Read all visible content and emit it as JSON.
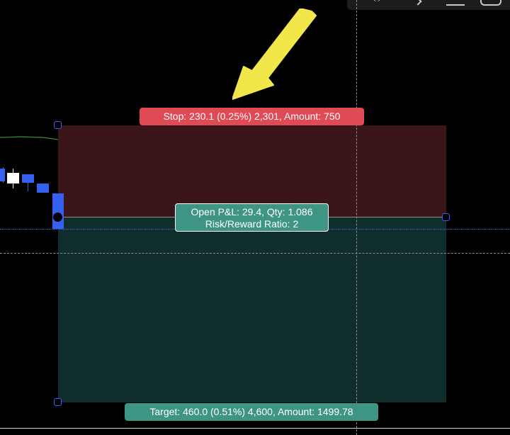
{
  "colors": {
    "background": "#000000",
    "stop_zone": "#3a1519",
    "target_zone": "#0f2d2a",
    "stop_label": "#e04a54",
    "target_label": "#3f9583",
    "handle": "#3d5cff",
    "candle_down": "#3560f0",
    "candle_up": "#ffffff",
    "moving_average": "#3a8a3a",
    "annotation_arrow": "#f2e74a"
  },
  "position_tool": {
    "stop_label": "Stop: 230.1 (0.25%) 2,301, Amount: 750",
    "pnl_label": "Open P&L: 29.4, Qty: 1.086",
    "risk_reward_label": "Risk/Reward Ratio: 2",
    "target_label": "Target: 460.0 (0.51%) 4,600, Amount: 1499.78"
  },
  "toolbar": {
    "icons": [
      "magnet-icon",
      "chevron-right-icon",
      "measure-icon",
      "ruler-icon"
    ]
  },
  "annotation": {
    "icon": "arrow-down-left-icon"
  }
}
